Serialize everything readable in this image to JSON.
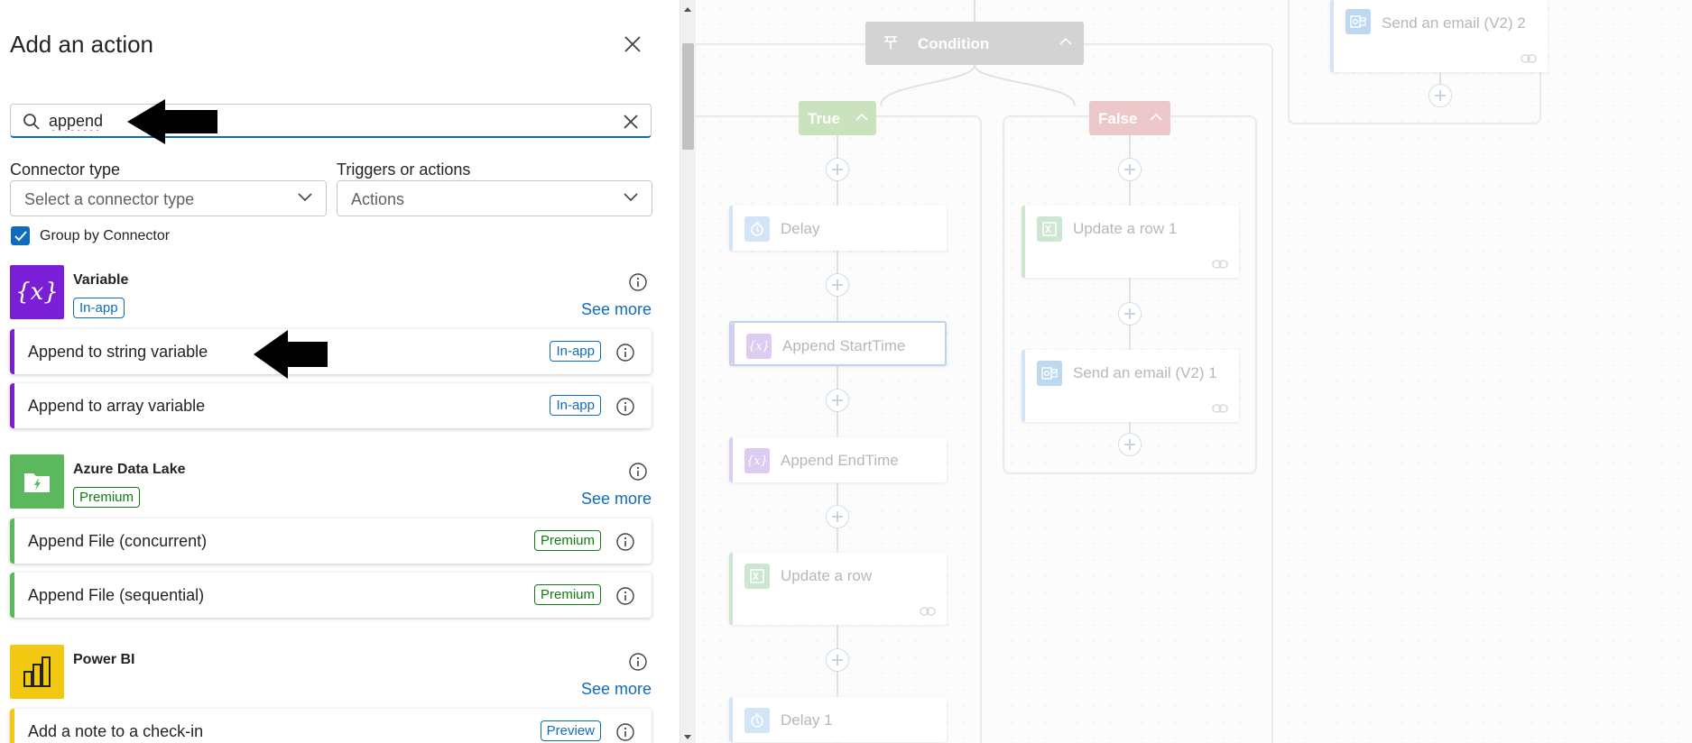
{
  "panel": {
    "title": "Add an action",
    "search": {
      "value": "append",
      "placeholder": "Search"
    },
    "filters": {
      "connector_type_label": "Connector type",
      "connector_type_value": "Select a connector type",
      "triggers_label": "Triggers or actions",
      "triggers_value": "Actions"
    },
    "group_by": {
      "label": "Group by Connector",
      "checked": true
    },
    "connectors": [
      {
        "name": "Variable",
        "badge": "In-app",
        "see_more": "See more",
        "color": "#7a1fd6",
        "actions": [
          {
            "label": "Append to string variable",
            "badge": "In-app"
          },
          {
            "label": "Append to array variable",
            "badge": "In-app"
          }
        ]
      },
      {
        "name": "Azure Data Lake",
        "badge": "Premium",
        "see_more": "See more",
        "color": "#5cb85c",
        "actions": [
          {
            "label": "Append File (concurrent)",
            "badge": "Premium"
          },
          {
            "label": "Append File (sequential)",
            "badge": "Premium"
          }
        ]
      },
      {
        "name": "Power BI",
        "badge": "",
        "see_more": "See more",
        "color": "#f2c811",
        "actions": [
          {
            "label": "Add a note to a check-in",
            "badge": "Preview"
          }
        ]
      }
    ]
  },
  "canvas": {
    "condition": {
      "label": "Condition"
    },
    "true_branch": {
      "label": "True",
      "color": "#8bbf6f"
    },
    "false_branch": {
      "label": "False",
      "color": "#d6868b"
    },
    "true_nodes": [
      "Delay",
      "Append StartTime",
      "Append EndTime",
      "Update a row",
      "Delay 1"
    ],
    "false_nodes": [
      "Update a row 1",
      "Send an email (V2) 1"
    ],
    "other_nodes": [
      "Send an email (V2) 2"
    ]
  }
}
